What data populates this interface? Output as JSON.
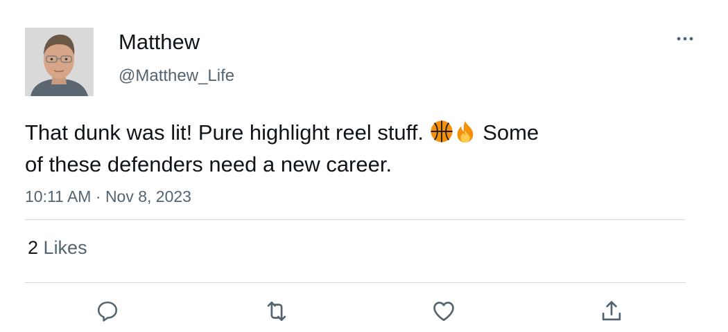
{
  "author": {
    "display_name": "Matthew",
    "handle": "@Matthew_Life",
    "avatar_icon": "profile-photo"
  },
  "tweet": {
    "text_line1_before_emoji": "That dunk was lit! Pure highlight reel stuff. ",
    "emojis": [
      "basketball-emoji",
      "fire-emoji"
    ],
    "text_line1_after_emoji": " Some",
    "text_line2": "of these defenders need a new career.",
    "time": "10:11 AM",
    "separator": "·",
    "date": "Nov 8, 2023"
  },
  "stats": {
    "likes_count": "2",
    "likes_label": "Likes"
  },
  "actions": [
    {
      "name": "reply",
      "icon": "reply-icon"
    },
    {
      "name": "retweet",
      "icon": "retweet-icon"
    },
    {
      "name": "like",
      "icon": "heart-icon"
    },
    {
      "name": "share",
      "icon": "share-icon"
    }
  ],
  "more_menu_icon": "more-icon",
  "colors": {
    "text_primary": "#0f1419",
    "text_secondary": "#536471",
    "divider": "#cfd9de"
  }
}
